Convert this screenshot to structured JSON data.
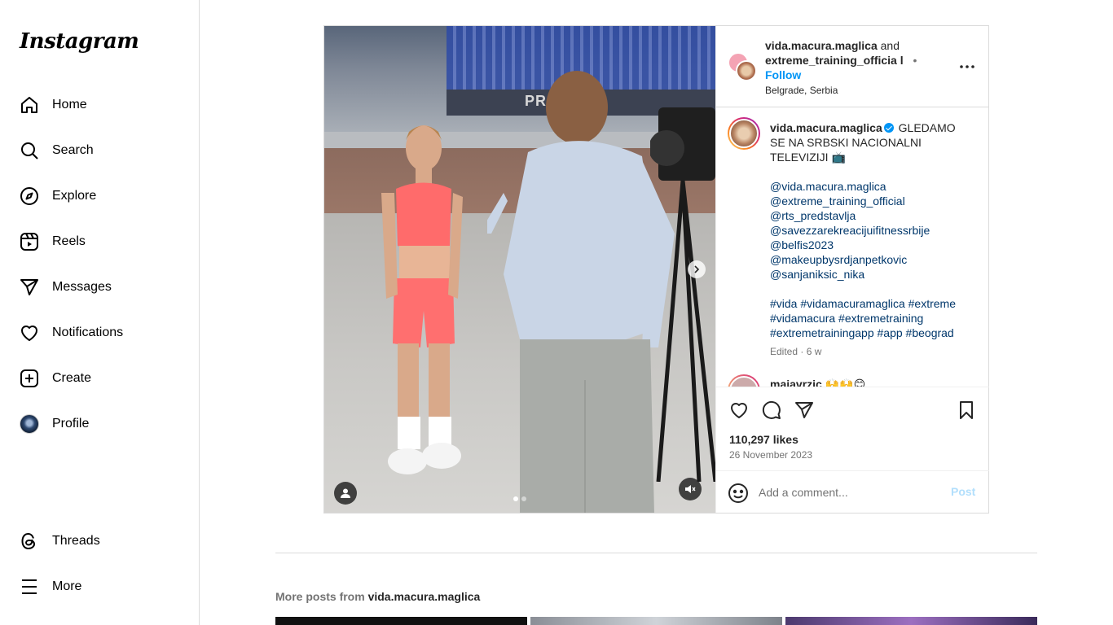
{
  "sidebar": {
    "logo": "Instagram",
    "items": [
      {
        "label": "Home",
        "icon": "home-icon"
      },
      {
        "label": "Search",
        "icon": "search-icon"
      },
      {
        "label": "Explore",
        "icon": "compass-icon"
      },
      {
        "label": "Reels",
        "icon": "reels-icon"
      },
      {
        "label": "Messages",
        "icon": "paper-plane-icon"
      },
      {
        "label": "Notifications",
        "icon": "heart-icon"
      },
      {
        "label": "Create",
        "icon": "plus-square-icon"
      },
      {
        "label": "Profile",
        "icon": "avatar"
      }
    ],
    "bottom_items": [
      {
        "label": "Threads",
        "icon": "threads-icon"
      },
      {
        "label": "More",
        "icon": "hamburger-icon"
      }
    ]
  },
  "post": {
    "media": {
      "banner_text": "PR",
      "carousel": {
        "count": 2,
        "active": 1
      }
    },
    "header": {
      "author": "vida.macura.maglica",
      "conjunction": "and",
      "collaborator": "extreme_training_officia l",
      "separator": "•",
      "follow_label": "Follow",
      "location": "Belgrade, Serbia"
    },
    "caption": {
      "author": "vida.macura.maglica",
      "text": "GLEDAMO SE NA SRBSKI NACIONALNI TELEVIZIJI 📺",
      "mentions": [
        "@vida.macura.maglica",
        "@extreme_training_official",
        "@rts_predstavlja",
        "@savezzarekreacijuifitnessrbije",
        "@belfis2023",
        "@makeupbysrdjanpetkovic",
        "@sanjaniksic_nika"
      ],
      "hashtags": "#vida #vidamacuramaglica #extreme #vidamacura #extremetraining #extremetrainingapp #app #beograd",
      "meta": "Edited · 6 w"
    },
    "comment_preview": {
      "author": "majavrzic",
      "text": "🙌🙌😊"
    },
    "likes": "110,297 likes",
    "date": "26 November 2023",
    "comment_box": {
      "placeholder": "Add a comment...",
      "post_label": "Post"
    }
  },
  "more_posts": {
    "prefix": "More posts from",
    "user": "vida.macura.maglica"
  },
  "colors": {
    "accent": "#0095f6",
    "link": "#00376b",
    "muted": "#737373",
    "border": "#dbdbdb"
  }
}
